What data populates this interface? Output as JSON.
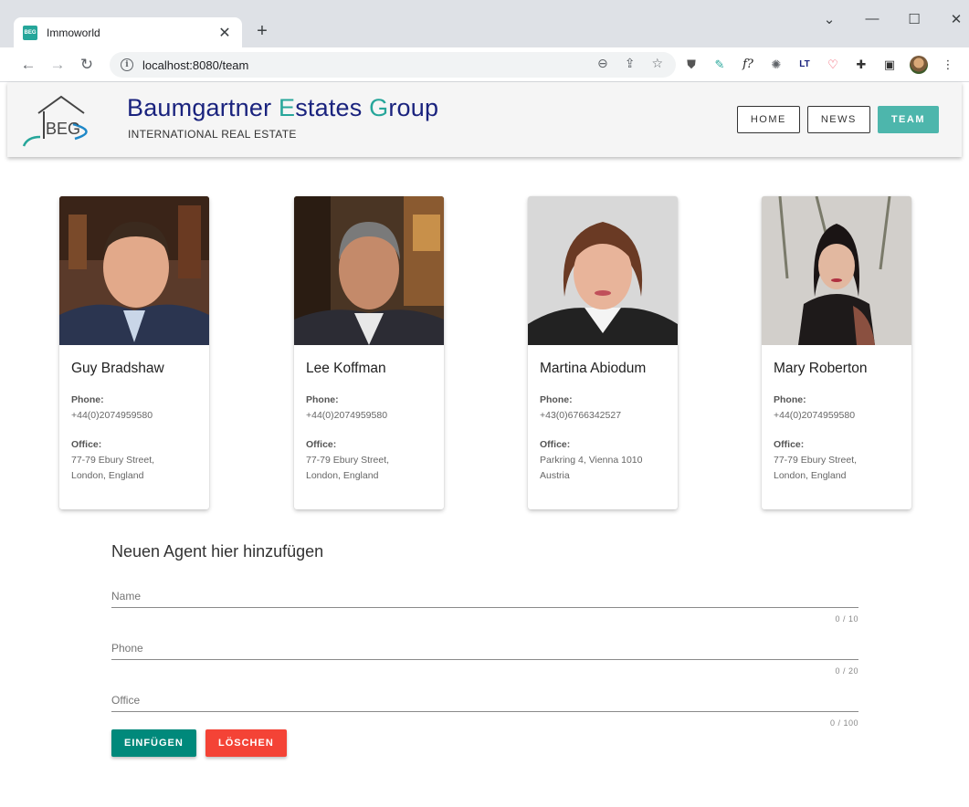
{
  "browser": {
    "tab_title": "Immoworld",
    "favicon_text": "BEG",
    "url": "localhost:8080/team",
    "icons": [
      "back-arrow-icon",
      "forward-arrow-icon",
      "reload-icon",
      "info-icon",
      "zoom-icon",
      "share-icon",
      "bookmark-star-icon",
      "ublock-icon",
      "eyedropper-icon",
      "font-icon",
      "chrome-icon",
      "languagetool-icon",
      "pocket-icon",
      "extensions-puzzle-icon",
      "sidepanel-icon",
      "profile-avatar",
      "menu-kebab-icon"
    ]
  },
  "header": {
    "logo_text": "BEG",
    "title_parts": [
      "B",
      "aumgartner ",
      "E",
      "states ",
      "G",
      "roup"
    ],
    "subtitle": "INTERNATIONAL REAL ESTATE",
    "nav": [
      {
        "label": "HOME",
        "active": false
      },
      {
        "label": "NEWS",
        "active": false
      },
      {
        "label": "TEAM",
        "active": true
      }
    ],
    "accent_color": "#26a69a",
    "brand_color": "#1a237e"
  },
  "agents": [
    {
      "name": "Guy Bradshaw",
      "phone_label": "Phone:",
      "phone": "+44(0)2074959580",
      "office_label": "Office:",
      "office_lines": [
        "77-79 Ebury Street,",
        "London, England"
      ]
    },
    {
      "name": "Lee Koffman",
      "phone_label": "Phone:",
      "phone": "+44(0)2074959580",
      "office_label": "Office:",
      "office_lines": [
        "77-79 Ebury Street,",
        "London, England"
      ]
    },
    {
      "name": "Martina Abiodum",
      "phone_label": "Phone:",
      "phone": "+43(0)6766342527",
      "office_label": "Office:",
      "office_lines": [
        "Parkring 4, Vienna 1010",
        "Austria"
      ]
    },
    {
      "name": "Mary Roberton",
      "phone_label": "Phone:",
      "phone": "+44(0)2074959580",
      "office_label": "Office:",
      "office_lines": [
        "77-79 Ebury Street,",
        "London, England"
      ]
    }
  ],
  "form": {
    "title": "Neuen Agent hier hinzufügen",
    "fields": [
      {
        "label": "Name",
        "counter": "0 / 10"
      },
      {
        "label": "Phone",
        "counter": "0 / 20"
      },
      {
        "label": "Office",
        "counter": "0 / 100"
      }
    ],
    "add_label": "EINFÜGEN",
    "delete_label": "LÖSCHEN",
    "add_color": "#00897b",
    "delete_color": "#f44336"
  }
}
